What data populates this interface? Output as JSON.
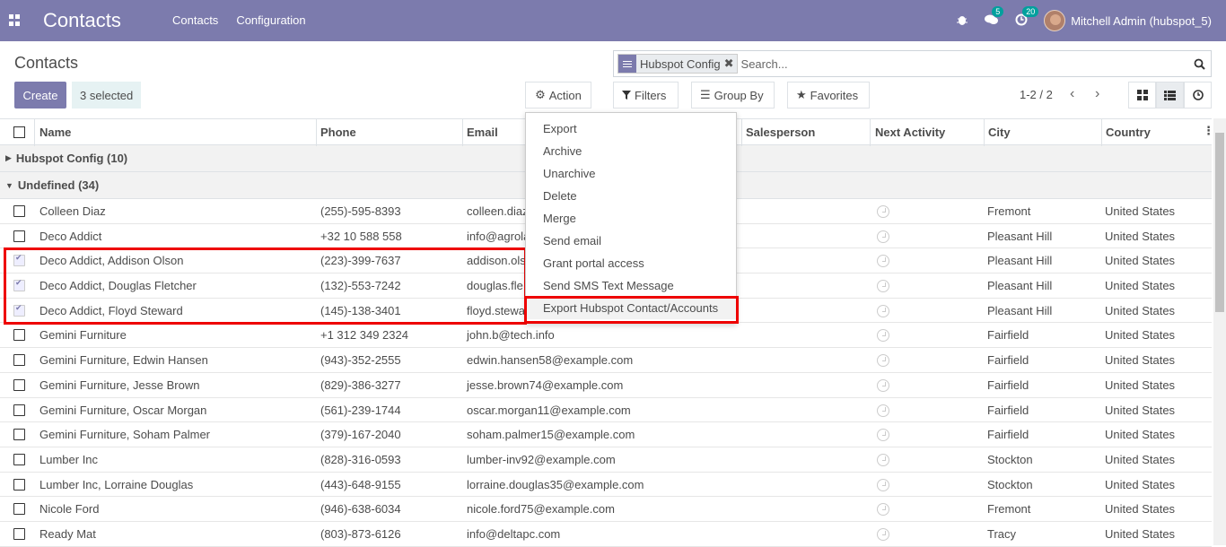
{
  "navbar": {
    "app_title": "Contacts",
    "menu": [
      "Contacts",
      "Configuration"
    ],
    "chat_count": "5",
    "activity_count": "20",
    "user": "Mitchell Admin (hubspot_5)"
  },
  "control": {
    "breadcrumb": "Contacts",
    "create_label": "Create",
    "selected_label": "3 selected",
    "action_label": "Action",
    "search_facet": "Hubspot Config",
    "search_placeholder": "Search...",
    "filters_label": "Filters",
    "groupby_label": "Group By",
    "favorites_label": "Favorites",
    "pager": "1-2 / 2"
  },
  "columns": [
    "Name",
    "Phone",
    "Email",
    "Salesperson",
    "Next Activity",
    "City",
    "Country"
  ],
  "groups": [
    {
      "label": "Hubspot Config (10)",
      "open": false
    },
    {
      "label": "Undefined (34)",
      "open": true
    }
  ],
  "rows": [
    {
      "name": "Colleen Diaz",
      "phone": "(255)-595-8393",
      "email": "colleen.diaz",
      "city": "Fremont",
      "country": "United States",
      "checked": false
    },
    {
      "name": "Deco Addict",
      "phone": "+32 10 588 558",
      "email": "info@agrola",
      "city": "Pleasant Hill",
      "country": "United States",
      "checked": false
    },
    {
      "name": "Deco Addict, Addison Olson",
      "phone": "(223)-399-7637",
      "email": "addison.ols",
      "city": "Pleasant Hill",
      "country": "United States",
      "checked": true
    },
    {
      "name": "Deco Addict, Douglas Fletcher",
      "phone": "(132)-553-7242",
      "email": "douglas.fle",
      "city": "Pleasant Hill",
      "country": "United States",
      "checked": true
    },
    {
      "name": "Deco Addict, Floyd Steward",
      "phone": "(145)-138-3401",
      "email": "floyd.stewa",
      "city": "Pleasant Hill",
      "country": "United States",
      "checked": true
    },
    {
      "name": "Gemini Furniture",
      "phone": "+1 312 349 2324",
      "email": "john.b@tech.info",
      "city": "Fairfield",
      "country": "United States",
      "checked": false
    },
    {
      "name": "Gemini Furniture, Edwin Hansen",
      "phone": "(943)-352-2555",
      "email": "edwin.hansen58@example.com",
      "city": "Fairfield",
      "country": "United States",
      "checked": false
    },
    {
      "name": "Gemini Furniture, Jesse Brown",
      "phone": "(829)-386-3277",
      "email": "jesse.brown74@example.com",
      "city": "Fairfield",
      "country": "United States",
      "checked": false
    },
    {
      "name": "Gemini Furniture, Oscar Morgan",
      "phone": "(561)-239-1744",
      "email": "oscar.morgan11@example.com",
      "city": "Fairfield",
      "country": "United States",
      "checked": false
    },
    {
      "name": "Gemini Furniture, Soham Palmer",
      "phone": "(379)-167-2040",
      "email": "soham.palmer15@example.com",
      "city": "Fairfield",
      "country": "United States",
      "checked": false
    },
    {
      "name": "Lumber Inc",
      "phone": "(828)-316-0593",
      "email": "lumber-inv92@example.com",
      "city": "Stockton",
      "country": "United States",
      "checked": false
    },
    {
      "name": "Lumber Inc, Lorraine Douglas",
      "phone": "(443)-648-9155",
      "email": "lorraine.douglas35@example.com",
      "city": "Stockton",
      "country": "United States",
      "checked": false
    },
    {
      "name": "Nicole Ford",
      "phone": "(946)-638-6034",
      "email": "nicole.ford75@example.com",
      "city": "Fremont",
      "country": "United States",
      "checked": false
    },
    {
      "name": "Ready Mat",
      "phone": "(803)-873-6126",
      "email": "info@deltapc.com",
      "city": "Tracy",
      "country": "United States",
      "checked": false
    }
  ],
  "action_menu": [
    "Export",
    "Archive",
    "Unarchive",
    "Delete",
    "Merge",
    "Send email",
    "Grant portal access",
    "Send SMS Text Message",
    "Export Hubspot Contact/Accounts"
  ],
  "colors": {
    "primary": "#7c7bad",
    "highlight": "#e00000"
  }
}
